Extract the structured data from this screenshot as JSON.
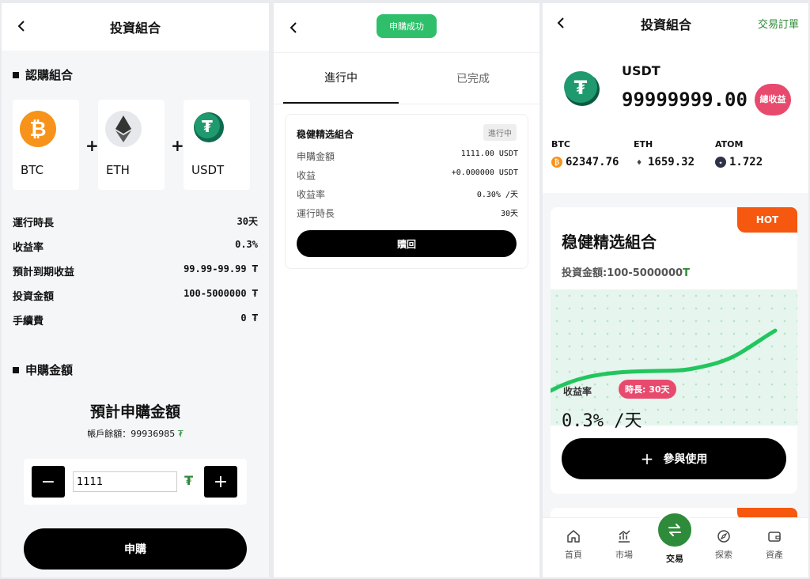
{
  "colors": {
    "accent_green": "#2e8b3a",
    "success_green": "#2fbf6a",
    "hot_orange": "#f5580e",
    "pink": "#e84a6e",
    "btc_orange": "#f7931a"
  },
  "subscribe_panel": {
    "title": "投資組合",
    "portfolio_heading": "認購組合",
    "coins": [
      {
        "name": "BTC",
        "icon": "bitcoin-icon"
      },
      {
        "name": "ETH",
        "icon": "ethereum-icon"
      },
      {
        "name": "USDT",
        "icon": "tether-icon"
      }
    ],
    "plus": "+",
    "details": [
      {
        "label": "運行時長",
        "value": "30天"
      },
      {
        "label": "收益率",
        "value": "0.3%"
      },
      {
        "label": "預計到期收益",
        "value": "99.99-99.99 ₮"
      },
      {
        "label": "投資金額",
        "value": "100-5000000 ₮"
      },
      {
        "label": "手續費",
        "value": "0 ₮"
      }
    ],
    "amount_heading": "申購金額",
    "estimate_title": "預計申購金額",
    "balance_label": "帳戶餘額：99936985",
    "balance_currency": "₮",
    "stepper": {
      "minus": "−",
      "plus": "+",
      "value": "1111",
      "currency": "₮"
    },
    "submit_label": "申購"
  },
  "orders_panel": {
    "toast": "申購成功",
    "tabs": [
      "進行中",
      "已完成"
    ],
    "order": {
      "name": "稳健精选組合",
      "status": "進行中",
      "rows": [
        {
          "label": "申購金額",
          "value": "1111.00 USDT"
        },
        {
          "label": "收益",
          "value": "+0.000000 USDT"
        },
        {
          "label": "收益率",
          "value": "0.30% /天"
        },
        {
          "label": "運行時長",
          "value": "30天"
        }
      ],
      "redeem_label": "贖回"
    }
  },
  "trade_panel": {
    "title": "投資組合",
    "orders_link": "交易訂單",
    "asset": {
      "symbol": "USDT",
      "amount": "99999999.00",
      "total_badge": "總收益"
    },
    "prices": [
      {
        "symbol": "BTC",
        "value": "62347.76",
        "color": "#f7931a",
        "glyph": "₿"
      },
      {
        "symbol": "ETH",
        "value": "1659.32",
        "color": "#ffffff",
        "glyph": "♦"
      },
      {
        "symbol": "ATOM",
        "value": "1.722",
        "color": "#2e3148",
        "glyph": "✦"
      }
    ],
    "product": {
      "hot": "HOT",
      "name": "稳健精选組合",
      "amount_label": "投資金額:100-5000000",
      "amount_currency": "T",
      "rate_label": "收益率",
      "duration_badge": "時長: 30天",
      "rate_value": "0.3% /天",
      "join_label": "參與使用",
      "join_plus": "+"
    },
    "nav": [
      {
        "label": "首頁",
        "icon": "home-icon"
      },
      {
        "label": "市場",
        "icon": "market-chart-icon"
      },
      {
        "label": "交易",
        "icon": "swap-icon"
      },
      {
        "label": "探索",
        "icon": "compass-icon"
      },
      {
        "label": "資產",
        "icon": "wallet-icon"
      }
    ]
  }
}
